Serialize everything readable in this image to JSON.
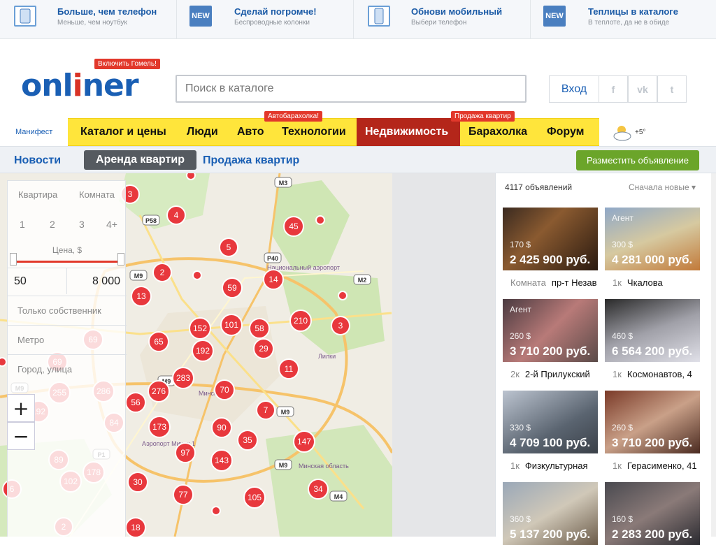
{
  "promo": [
    {
      "title": "Больше, чем телефон",
      "sub": "Меньше, чем ноутбук",
      "icon": "tablet-icon",
      "icon_text": ""
    },
    {
      "title": "Сделай погромче!",
      "sub": "Беспроводные колонки",
      "icon": "new-badge-icon",
      "icon_text": "NEW"
    },
    {
      "title": "Обнови мобильный",
      "sub": "Выбери телефон",
      "icon": "phone-icon",
      "icon_text": ""
    },
    {
      "title": "Теплицы в каталоге",
      "sub": "В теплоте, да не в обиде",
      "icon": "new-badge-icon",
      "icon_text": "NEW"
    }
  ],
  "header": {
    "logo_a": "onl",
    "logo_i": "i",
    "logo_b": "ner",
    "badge": "Включить Гомель!",
    "search_placeholder": "Поиск в каталоге",
    "login": "Вход",
    "social": [
      "f",
      "vk",
      "t"
    ]
  },
  "nav": {
    "manifest": "Манифест",
    "items": [
      "Каталог и цены",
      "Люди",
      "Авто",
      "Технологии",
      "Недвижимость",
      "Барахолка",
      "Форум"
    ],
    "tag_auto": "Автобарахолка!",
    "tag_realty": "Продажа квартир",
    "temperature": "+5°"
  },
  "subnav": {
    "news": "Новости",
    "rent": "Аренда квартир",
    "sale": "Продажа квартир",
    "post": "Разместить объявление"
  },
  "filter": {
    "types": [
      "Квартира",
      "Комната"
    ],
    "rooms": [
      "1",
      "2",
      "3",
      "4+"
    ],
    "price_label": "Цена, $",
    "price_min": "50",
    "price_max": "8 000",
    "owner": "Только собственник",
    "metro": "Метро",
    "city": "Город, улица"
  },
  "map": {
    "zoom_in": "+",
    "zoom_out": "−",
    "roads": [
      "М3",
      "Р58",
      "Р40",
      "М2",
      "М9",
      "М9",
      "М9",
      "М9",
      "М9",
      "Р1",
      "М4"
    ],
    "places": [
      "Минск",
      "Аэропорт Минск-1",
      "Минская область",
      "Лилки",
      "Национальный аэропорт"
    ],
    "clusters": [
      "3",
      "4",
      "45",
      "5",
      "2",
      "14",
      "59",
      "13",
      "152",
      "101",
      "58",
      "210",
      "3",
      "192",
      "65",
      "29",
      "11",
      "283",
      "276",
      "255",
      "286",
      "56",
      "70",
      "7",
      "192",
      "84",
      "173",
      "90",
      "35",
      "147",
      "89",
      "178",
      "97",
      "143",
      "102",
      "6",
      "30",
      "77",
      "105",
      "34",
      "2",
      "18",
      "69",
      "69"
    ]
  },
  "list": {
    "count": "4117 объявлений",
    "sort": "Сначала новые",
    "cards": [
      {
        "tag": "",
        "usd": "170 $",
        "byr": "2 425 900 руб.",
        "rooms": "Комната",
        "street": "пр-т Незав"
      },
      {
        "tag": "Агент",
        "usd": "300 $",
        "byr": "4 281 000 руб.",
        "rooms": "1к",
        "street": "Чкалова"
      },
      {
        "tag": "Агент",
        "usd": "260 $",
        "byr": "3 710 200 руб.",
        "rooms": "2к",
        "street": "2-й Прилукский"
      },
      {
        "tag": "",
        "usd": "460 $",
        "byr": "6 564 200 руб.",
        "rooms": "1к",
        "street": "Космонавтов, 4"
      },
      {
        "tag": "",
        "usd": "330 $",
        "byr": "4 709 100 руб.",
        "rooms": "1к",
        "street": "Физкультурная"
      },
      {
        "tag": "",
        "usd": "260 $",
        "byr": "3 710 200 руб.",
        "rooms": "1к",
        "street": "Герасименко, 41"
      },
      {
        "tag": "",
        "usd": "360 $",
        "byr": "5 137 200 руб.",
        "rooms": "",
        "street": ""
      },
      {
        "tag": "",
        "usd": "160 $",
        "byr": "2 283 200 руб.",
        "rooms": "",
        "street": ""
      }
    ]
  }
}
